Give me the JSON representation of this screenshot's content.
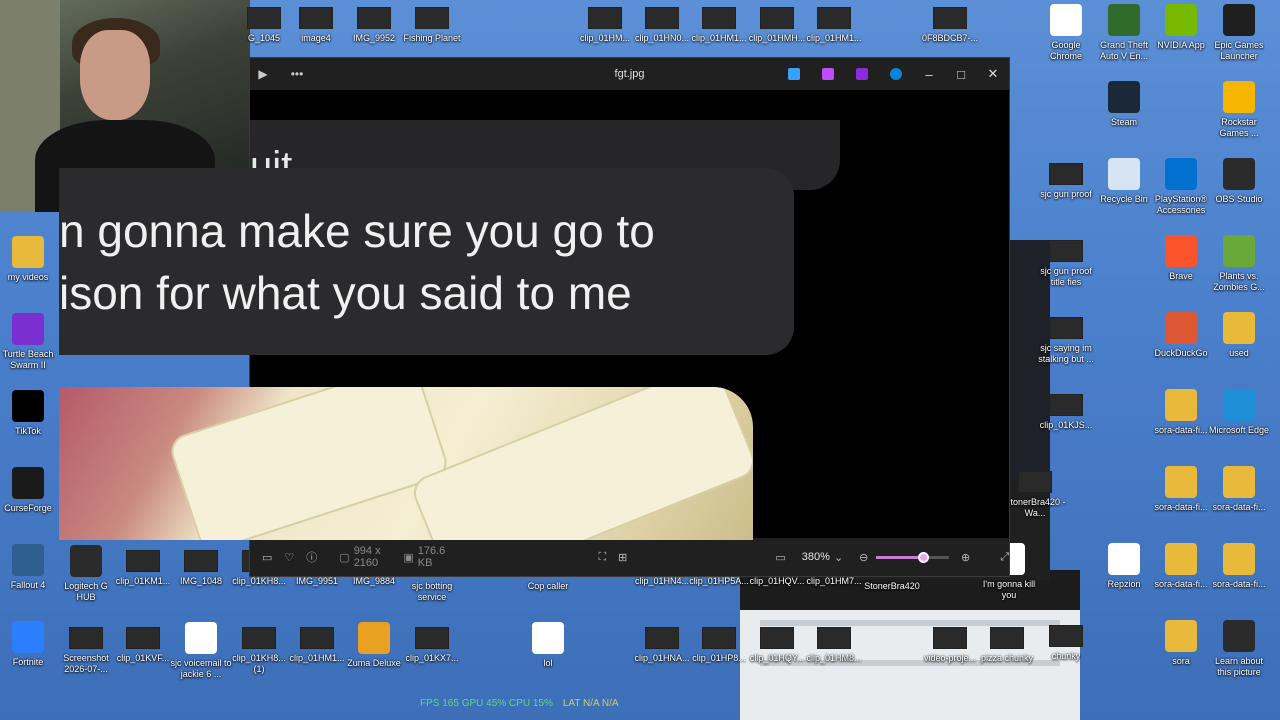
{
  "window": {
    "title": "fgt.jpg",
    "image_text_top": "uit",
    "image_text_line1": "n gonna make sure you go to",
    "image_text_line2": "ison for what you said to me",
    "dimensions": "994 x 2160",
    "file_size": "176.6 KB",
    "zoom_level": "380%",
    "zoom_slider_level": 0.5
  },
  "desktop_top_row": [
    {
      "label": "G_1045",
      "kind": "thumb"
    },
    {
      "label": "image4",
      "kind": "thumb"
    },
    {
      "label": "IMG_9952",
      "kind": "thumb"
    },
    {
      "label": "Fishing Planet",
      "kind": "thumb"
    },
    {
      "label": "clip_01HM...",
      "kind": "thumb"
    },
    {
      "label": "clip_01HN0...",
      "kind": "thumb"
    },
    {
      "label": "clip_01HM1...",
      "kind": "thumb"
    },
    {
      "label": "clip_01HMH...",
      "kind": "thumb"
    },
    {
      "label": "clip_01HM1...",
      "kind": "thumb"
    },
    {
      "label": "0F8BDCB7-...",
      "kind": "thumb"
    }
  ],
  "desktop_right": [
    {
      "label": "Google Chrome",
      "color": "#ffffff"
    },
    {
      "label": "Grand Theft Auto V En...",
      "color": "#2f6b2a"
    },
    {
      "label": "NVIDIA App",
      "color": "#76b900"
    },
    {
      "label": "Epic Games Launcher",
      "color": "#1f1f1f"
    },
    {
      "label": "Steam",
      "color": "#1b2838"
    },
    {
      "label": "Rockstar Games ...",
      "color": "#f6b600"
    },
    {
      "label": "sjc gun proof",
      "color": "#333333"
    },
    {
      "label": "Recycle Bin",
      "color": "#d7e4f4"
    },
    {
      "label": "PlayStation® Accessories",
      "color": "#0070d1"
    },
    {
      "label": "OBS Studio",
      "color": "#2b2b2b"
    },
    {
      "label": "sjc gun proof title fies",
      "color": "#333333"
    },
    {
      "label": "Brave",
      "color": "#fb542b"
    },
    {
      "label": "Plants vs. Zombies G...",
      "color": "#6aa83a"
    },
    {
      "label": "sjc saying im stalking but ...",
      "color": "#333333"
    },
    {
      "label": "DuckDuckGo",
      "color": "#de5833"
    },
    {
      "label": "used",
      "color": "#e8b93b"
    },
    {
      "label": "clip_01KJS...",
      "color": "#333333"
    },
    {
      "label": "sora-data-fi...",
      "color": "#e8b93b"
    },
    {
      "label": "Microsoft Edge",
      "color": "#1f8fd8"
    },
    {
      "label": "StonerBra420 - Wa...",
      "color": "#333333"
    },
    {
      "label": "sora-data-fi...",
      "color": "#e8b93b"
    },
    {
      "label": "sora-data-fi...",
      "color": "#e8b93b"
    },
    {
      "label": "I'm gonna kill you",
      "color": "#ffffff"
    },
    {
      "label": "Repzion",
      "color": "#ffffff"
    },
    {
      "label": "sora-data-fi...",
      "color": "#e8b93b"
    },
    {
      "label": "sora-data-fi...",
      "color": "#e8b93b"
    },
    {
      "label": "chunky",
      "color": "#333333"
    },
    {
      "label": "sora",
      "color": "#e8b93b"
    },
    {
      "label": "Learn about this picture",
      "color": "#2b2b2b"
    }
  ],
  "desktop_left": [
    {
      "label": "my videos",
      "color": "#e8b93b"
    },
    {
      "label": "Turtle Beach Swarm II",
      "color": "#7b2fd0"
    },
    {
      "label": "TikTok",
      "color": "#000000"
    },
    {
      "label": "CurseForge",
      "color": "#1a1a1a"
    },
    {
      "label": "Fallout 4",
      "color": "#2f5e91"
    },
    {
      "label": "Fortnite",
      "color": "#2b7fff"
    }
  ],
  "desktop_bottom_row1": [
    "Logitech G HUB",
    "clip_01KM1...",
    "IMG_1048",
    "clip_01KH8...",
    "IMG_9951",
    "IMG_9884",
    "sjc botting service",
    "Cop caller",
    "clip_01HN4...",
    "clip_01HP5A...",
    "clip_01HQV...",
    "clip_01HM7...",
    "StonerBra420"
  ],
  "desktop_bottom_row2": [
    "Screenshot 2026-07-...",
    "clip_01KVF...",
    "sjc voicemail to jackie 6 ...",
    "clip_01KH8... (1)",
    "clip_01HM1...",
    "Zuma Deluxe",
    "clip_01KX7...",
    "lol",
    "clip_01HNA...",
    "clip_01HP8...",
    "clip_01HQY...",
    "clip_01HM8...",
    "video-proje...",
    "pizza chunky"
  ],
  "statusbar": {
    "left": "FPS 165  GPU 45%  CPU 15%",
    "lat": "LAT N/A N/A"
  }
}
